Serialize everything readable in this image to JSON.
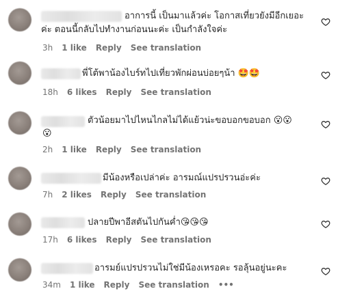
{
  "comments": [
    {
      "text_line1": "อาการนี้ เป็นมาแล้วค่ะ โอกาสเที่ยวยังมีอีกเยอะ",
      "text_line2": "ค่ะ ตอนนี้กลับไปทำงานก่อนนะค่ะ เป็นกำลังใจค่ะ",
      "time": "3h",
      "likes": "1 like",
      "reply": "Reply",
      "translate": "See translation"
    },
    {
      "text_line1": "พี่โต้พาน้องไบร์ทไปเที่ยวพักผ่อนบ่อยๆน้า 🤩🤩",
      "time": "18h",
      "likes": "6 likes",
      "reply": "Reply",
      "translate": "See translation"
    },
    {
      "text_line1": "ตัวน้อยมาไปไหนไกลไม่ได้แย้วน่ะขอบอกขอบอก 😮😮",
      "text_line2": "😮",
      "time": "2h",
      "likes": "1 like",
      "reply": "Reply",
      "translate": "See translation"
    },
    {
      "text_line1": "มีน้องหรือเปล่าค่ะ อารมณ์แปรปรวนอ่ะค่ะ",
      "time": "7h",
      "likes": "2 likes",
      "reply": "Reply",
      "translate": "See translation"
    },
    {
      "text_line1": "ปลายปีพาอีสตันไปกันค่ำ😘😘😘",
      "time": "17h",
      "likes": "6 likes",
      "reply": "Reply",
      "translate": "See translation"
    },
    {
      "text_line1": "อารมย์แปรปรวนไม่ใช่มีน้องเหรอคะ รอลุ้นอยู่นะคะ",
      "time": "34m",
      "likes": "1 like",
      "reply": "Reply",
      "translate": "See translation",
      "more": "•••"
    }
  ],
  "icons": {
    "like": "heart-outline-icon",
    "avatar": "blurred-avatar"
  },
  "colors": {
    "text": "#262626",
    "meta": "#737373"
  }
}
